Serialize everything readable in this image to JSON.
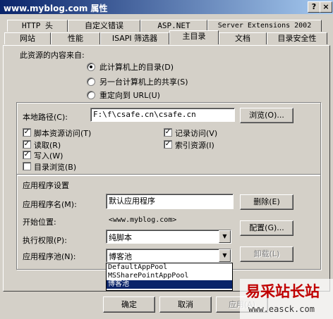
{
  "window": {
    "title": "www.myblog.com 属性",
    "help_btn": "?",
    "close_btn": "×"
  },
  "tabs_row1": [
    "HTTP 头",
    "自定义错误",
    "ASP.NET",
    "Server Extensions 2002"
  ],
  "tabs_row2": [
    "网站",
    "性能",
    "ISAPI 筛选器",
    "主目录",
    "文档",
    "目录安全性"
  ],
  "content_source": {
    "label": "此资源的内容来自:",
    "options": [
      "此计算机上的目录(D)",
      "另一台计算机上的共享(S)",
      "重定向到 URL(U)"
    ]
  },
  "local_path": {
    "label": "本地路径(C):",
    "value": "F:\\f\\csafe.cn\\csafe.cn",
    "browse_btn": "浏览(O)..."
  },
  "checks": {
    "script_access": "脚本资源访问(T)",
    "read": "读取(R)",
    "write": "写入(W)",
    "dir_browse": "目录浏览(B)",
    "log_visits": "记录访问(V)",
    "index": "索引资源(I)"
  },
  "app_settings": {
    "section_label": "应用程序设置",
    "app_name_label": "应用程序名(M):",
    "app_name_value": "默认应用程序",
    "remove_btn": "删除(E)",
    "start_label": "开始位置:",
    "start_value": "<www.myblog.com>",
    "config_btn": "配置(G)...",
    "exec_label": "执行权限(P):",
    "exec_value": "纯脚本",
    "pool_label": "应用程序池(N):",
    "pool_value": "博客池",
    "unload_btn": "卸载(L)",
    "pool_options": [
      "DefaultAppPool",
      "MSSharePointAppPool",
      "博客池"
    ]
  },
  "bottom_buttons": {
    "ok": "确定",
    "cancel": "取消",
    "apply": "应用(A)"
  },
  "watermark": {
    "line1": "易采站长站",
    "line2": "www.easck.com"
  }
}
